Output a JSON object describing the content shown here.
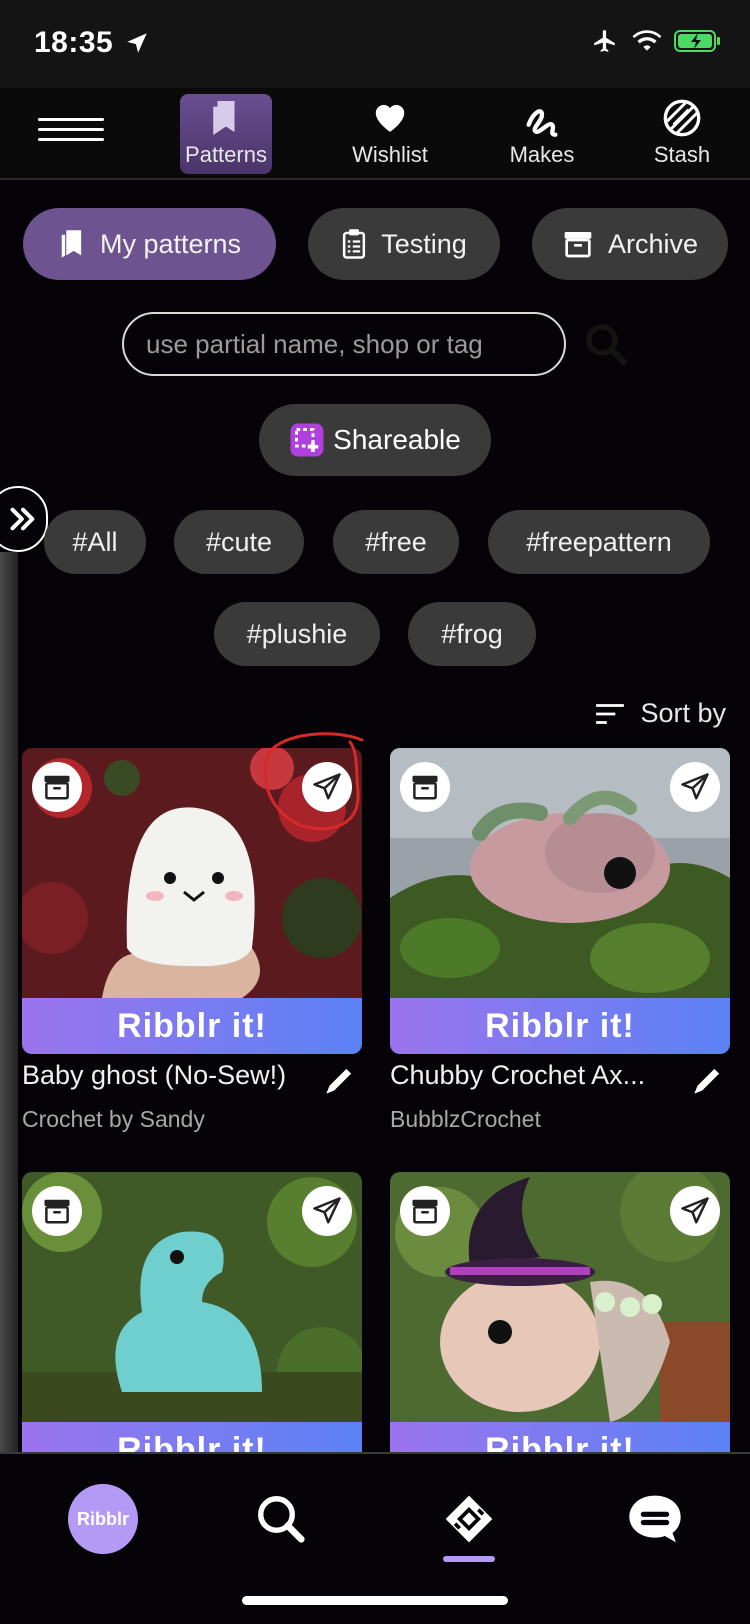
{
  "status": {
    "time": "18:35"
  },
  "nav": {
    "tabs": [
      {
        "label": "Patterns",
        "icon": "bookmark-icon",
        "active": true
      },
      {
        "label": "Wishlist",
        "icon": "heart-icon"
      },
      {
        "label": "Makes",
        "icon": "yarn-squiggle-icon"
      },
      {
        "label": "Stash",
        "icon": "yarn-ball-icon"
      }
    ]
  },
  "segments": [
    {
      "label": "My patterns",
      "icon": "bookmark-icon",
      "active": true
    },
    {
      "label": "Testing",
      "icon": "clipboard-icon"
    },
    {
      "label": "Archive",
      "icon": "archive-icon"
    }
  ],
  "search": {
    "placeholder": "use partial name, shop or tag"
  },
  "shareable": {
    "label": "Shareable"
  },
  "tags": [
    "#All",
    "#cute",
    "#free",
    "#freepattern",
    "#plushie",
    "#frog"
  ],
  "sort": {
    "label": "Sort by"
  },
  "cards": [
    {
      "title": "Baby ghost (No-Sew!)",
      "shop": "Crochet by Sandy",
      "cta": "Ribblr it!"
    },
    {
      "title": "Chubby Crochet Ax...",
      "shop": "BubblzCrochet",
      "cta": "Ribblr it!"
    },
    {
      "title": "",
      "shop": "",
      "cta": "Ribblr it!"
    },
    {
      "title": "",
      "shop": "",
      "cta": "Ribblr it!"
    }
  ],
  "bottom": {
    "avatar_label": "Ribblr"
  },
  "colors": {
    "accent": "#6d5390",
    "cta_start": "#9b74ee",
    "cta_end": "#5b82f5",
    "pill": "#3a3a3a"
  }
}
